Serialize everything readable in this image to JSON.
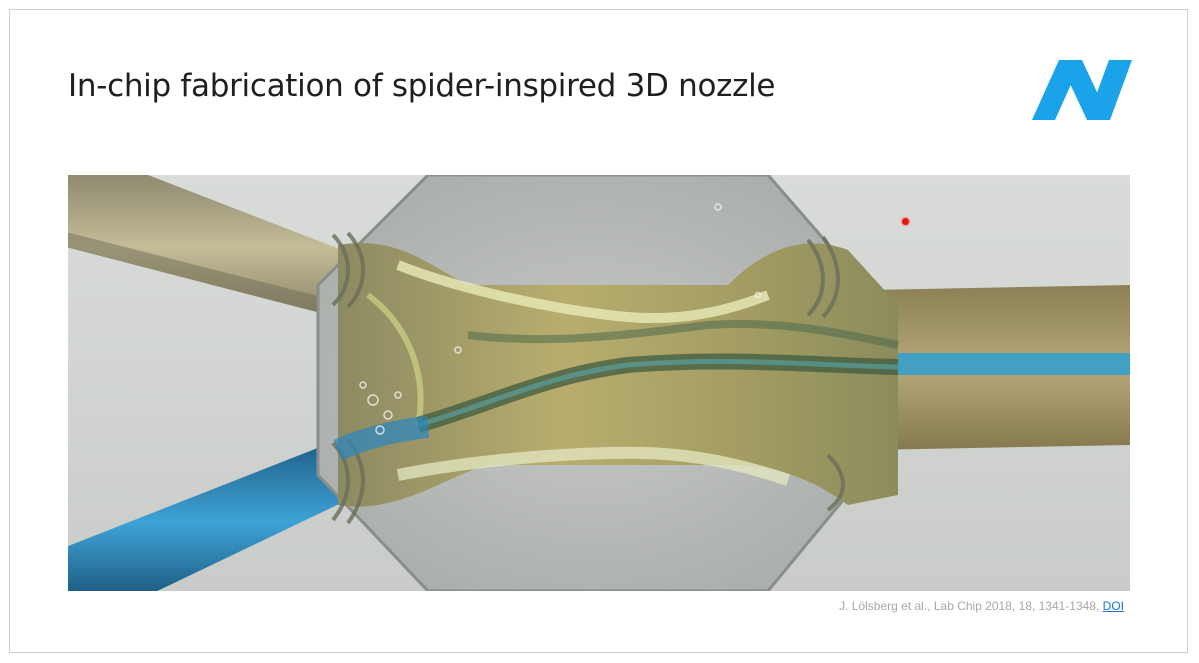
{
  "slide": {
    "title": "In-chip fabrication of spider-inspired 3D nozzle",
    "logo_icon": "brand-n-logo",
    "figure_icon": "microscope-photo-nozzle",
    "citation": {
      "text": "J. Lölsberg et al., Lab Chip 2018, 18, 1341-1348, ",
      "link": "DOI"
    }
  },
  "colors": {
    "logo": "#1aa3e8",
    "title": "#1f1f1f",
    "citation": "#a8a8a8",
    "link": "#1a73c9",
    "pointer": "#e01818"
  }
}
